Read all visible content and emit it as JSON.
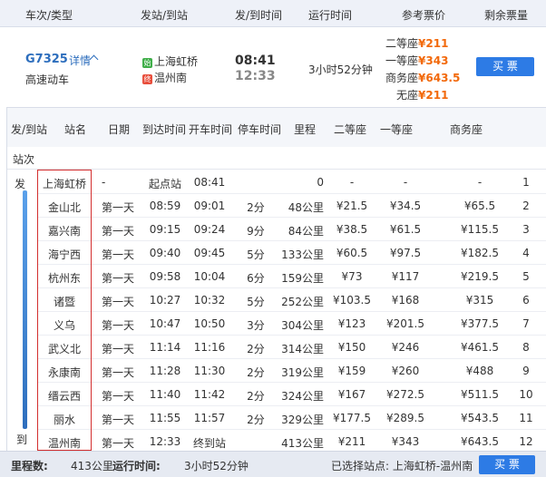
{
  "header": {
    "train_type": "车次/类型",
    "stations": "发站/到站",
    "times": "发/到时间",
    "duration": "运行时间",
    "price": "参考票价",
    "remaining": "剩余票量"
  },
  "train": {
    "number": "G7325",
    "detail": "详情",
    "type": "高速动车",
    "from_badge": "始",
    "from": "上海虹桥",
    "to_badge": "终",
    "to": "温州南",
    "dep_time": "08:41",
    "arr_time": "12:33",
    "duration": "3小时52分钟",
    "prices": [
      {
        "label": "二等座",
        "value": "¥211"
      },
      {
        "label": "一等座",
        "value": "¥343"
      },
      {
        "label": "商务座",
        "value": "¥643.5"
      },
      {
        "label": "无座",
        "value": "¥211"
      }
    ],
    "buy": "买 票"
  },
  "timetable": {
    "headers": {
      "dep_arr": "发/到站",
      "name": "站名",
      "date": "日期",
      "arr": "到达时间",
      "dep": "开车时间",
      "stop": "停车时间",
      "km": "里程",
      "p2": "二等座",
      "p1": "一等座",
      "pb": "商务座"
    },
    "sub_label": "站次",
    "rail_top": "发",
    "rail_bottom": "到",
    "rows": [
      {
        "name": "上海虹桥",
        "day": "-",
        "arr": "起点站",
        "dep": "08:41",
        "stop": "",
        "km": "0",
        "p2": "-",
        "p1": "-",
        "pb": "-",
        "idx": "1"
      },
      {
        "name": "金山北",
        "day": "第一天",
        "arr": "08:59",
        "dep": "09:01",
        "stop": "2分",
        "km": "48公里",
        "p2": "¥21.5",
        "p1": "¥34.5",
        "pb": "¥65.5",
        "idx": "2"
      },
      {
        "name": "嘉兴南",
        "day": "第一天",
        "arr": "09:15",
        "dep": "09:24",
        "stop": "9分",
        "km": "84公里",
        "p2": "¥38.5",
        "p1": "¥61.5",
        "pb": "¥115.5",
        "idx": "3"
      },
      {
        "name": "海宁西",
        "day": "第一天",
        "arr": "09:40",
        "dep": "09:45",
        "stop": "5分",
        "km": "133公里",
        "p2": "¥60.5",
        "p1": "¥97.5",
        "pb": "¥182.5",
        "idx": "4"
      },
      {
        "name": "杭州东",
        "day": "第一天",
        "arr": "09:58",
        "dep": "10:04",
        "stop": "6分",
        "km": "159公里",
        "p2": "¥73",
        "p1": "¥117",
        "pb": "¥219.5",
        "idx": "5"
      },
      {
        "name": "诸暨",
        "day": "第一天",
        "arr": "10:27",
        "dep": "10:32",
        "stop": "5分",
        "km": "252公里",
        "p2": "¥103.5",
        "p1": "¥168",
        "pb": "¥315",
        "idx": "6"
      },
      {
        "name": "义乌",
        "day": "第一天",
        "arr": "10:47",
        "dep": "10:50",
        "stop": "3分",
        "km": "304公里",
        "p2": "¥123",
        "p1": "¥201.5",
        "pb": "¥377.5",
        "idx": "7"
      },
      {
        "name": "武义北",
        "day": "第一天",
        "arr": "11:14",
        "dep": "11:16",
        "stop": "2分",
        "km": "314公里",
        "p2": "¥150",
        "p1": "¥246",
        "pb": "¥461.5",
        "idx": "8"
      },
      {
        "name": "永康南",
        "day": "第一天",
        "arr": "11:28",
        "dep": "11:30",
        "stop": "2分",
        "km": "319公里",
        "p2": "¥159",
        "p1": "¥260",
        "pb": "¥488",
        "idx": "9"
      },
      {
        "name": "缙云西",
        "day": "第一天",
        "arr": "11:40",
        "dep": "11:42",
        "stop": "2分",
        "km": "324公里",
        "p2": "¥167",
        "p1": "¥272.5",
        "pb": "¥511.5",
        "idx": "10"
      },
      {
        "name": "丽水",
        "day": "第一天",
        "arr": "11:55",
        "dep": "11:57",
        "stop": "2分",
        "km": "329公里",
        "p2": "¥177.5",
        "p1": "¥289.5",
        "pb": "¥543.5",
        "idx": "11"
      },
      {
        "name": "温州南",
        "day": "第一天",
        "arr": "12:33",
        "dep": "终到站",
        "stop": "",
        "km": "413公里",
        "p2": "¥211",
        "p1": "¥343",
        "pb": "¥643.5",
        "idx": "12"
      }
    ]
  },
  "footer": {
    "km_label": "里程数:",
    "km_value": "413公里",
    "time_label": "运行时间:",
    "time_value": "3小时52分钟",
    "selected": "已选择站点: 上海虹桥-温州南",
    "buy": "买 票"
  }
}
